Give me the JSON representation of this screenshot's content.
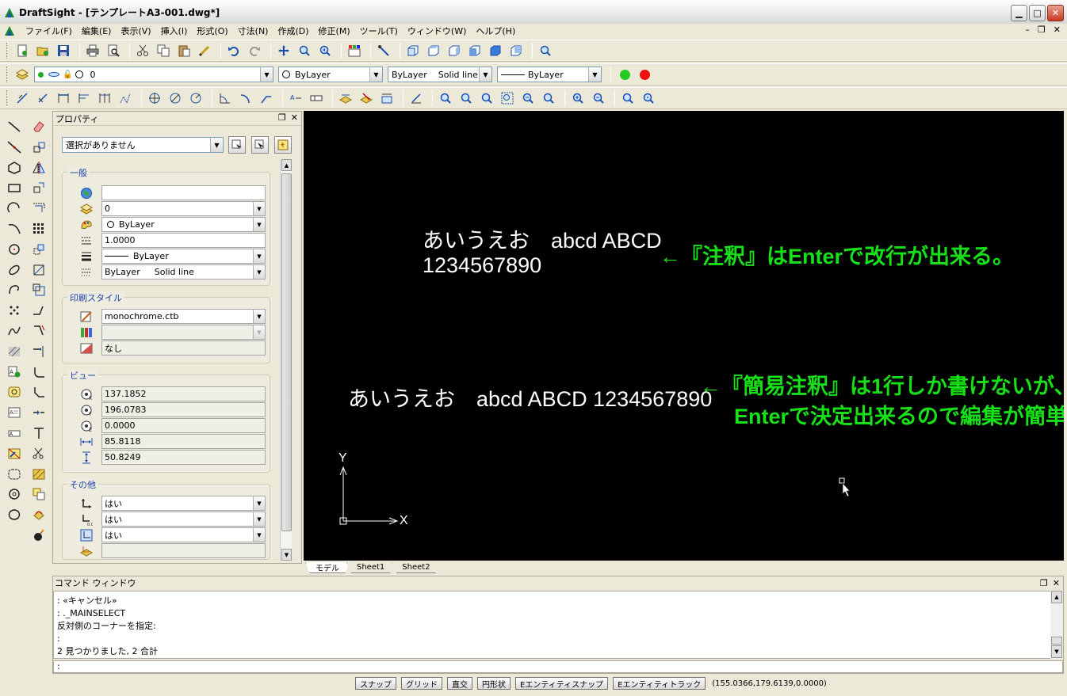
{
  "window": {
    "title": "DraftSight - [テンプレートA3-001.dwg*]"
  },
  "menu": [
    "ファイル(F)",
    "編集(E)",
    "表示(V)",
    "挿入(I)",
    "形式(O)",
    "寸法(N)",
    "作成(D)",
    "修正(M)",
    "ツール(T)",
    "ウィンドウ(W)",
    "ヘルプ(H)"
  ],
  "layer_toolbar": {
    "layer_value": "0",
    "color_value": "ByLayer",
    "linestyle_value": "ByLayer",
    "linestyle_name": "Solid line",
    "lineweight_value": "ByLayer"
  },
  "colors": {
    "green_dot": "#22cc22",
    "red_dot": "#ee1111",
    "canvas_bg": "#000000",
    "note_green": "#18e018"
  },
  "properties": {
    "title": "プロパティ",
    "selection": "選択がありません",
    "groups": {
      "general": {
        "title": "一般",
        "rows": [
          "",
          "0",
          "ByLayer",
          "1.0000",
          "ByLayer",
          "ByLayer"
        ],
        "linestyle_name": "Solid line"
      },
      "print_style": {
        "title": "印刷スタイル",
        "rows": [
          "monochrome.ctb",
          "",
          "なし"
        ]
      },
      "view": {
        "title": "ビュー",
        "rows": [
          "137.1852",
          "196.0783",
          "0.0000",
          "85.8118",
          "50.8249"
        ]
      },
      "other": {
        "title": "その他",
        "rows": [
          "はい",
          "はい",
          "はい",
          ""
        ]
      }
    }
  },
  "canvas": {
    "mtext_line1": "あいうえお　abcd ABCD",
    "mtext_line2": "1234567890",
    "note1": "←『注釈』はEnterで改行が出来る。",
    "simple_text": "あいうえお　abcd ABCD 1234567890",
    "note2_line1": "←『簡易注釈』は1行しか書けないが、",
    "note2_line2": "Enterで決定出来るので編集が簡単。",
    "axis_y": "Y",
    "axis_x": "X"
  },
  "tabs": [
    "モデル",
    "Sheet1",
    "Sheet2"
  ],
  "command": {
    "title": "コマンド ウィンドウ",
    "lines": [
      ": «キャンセル»",
      ": ._MAINSELECT",
      "反対側のコーナーを指定:",
      ":",
      "2 見つかりました, 2 合計"
    ],
    "input": ":"
  },
  "status": {
    "buttons": [
      "スナップ",
      "グリッド",
      "直交",
      "円形状",
      "Eエンティティスナップ",
      "Eエンティティトラック"
    ],
    "coords": "(155.0366,179.6139,0.0000)"
  }
}
